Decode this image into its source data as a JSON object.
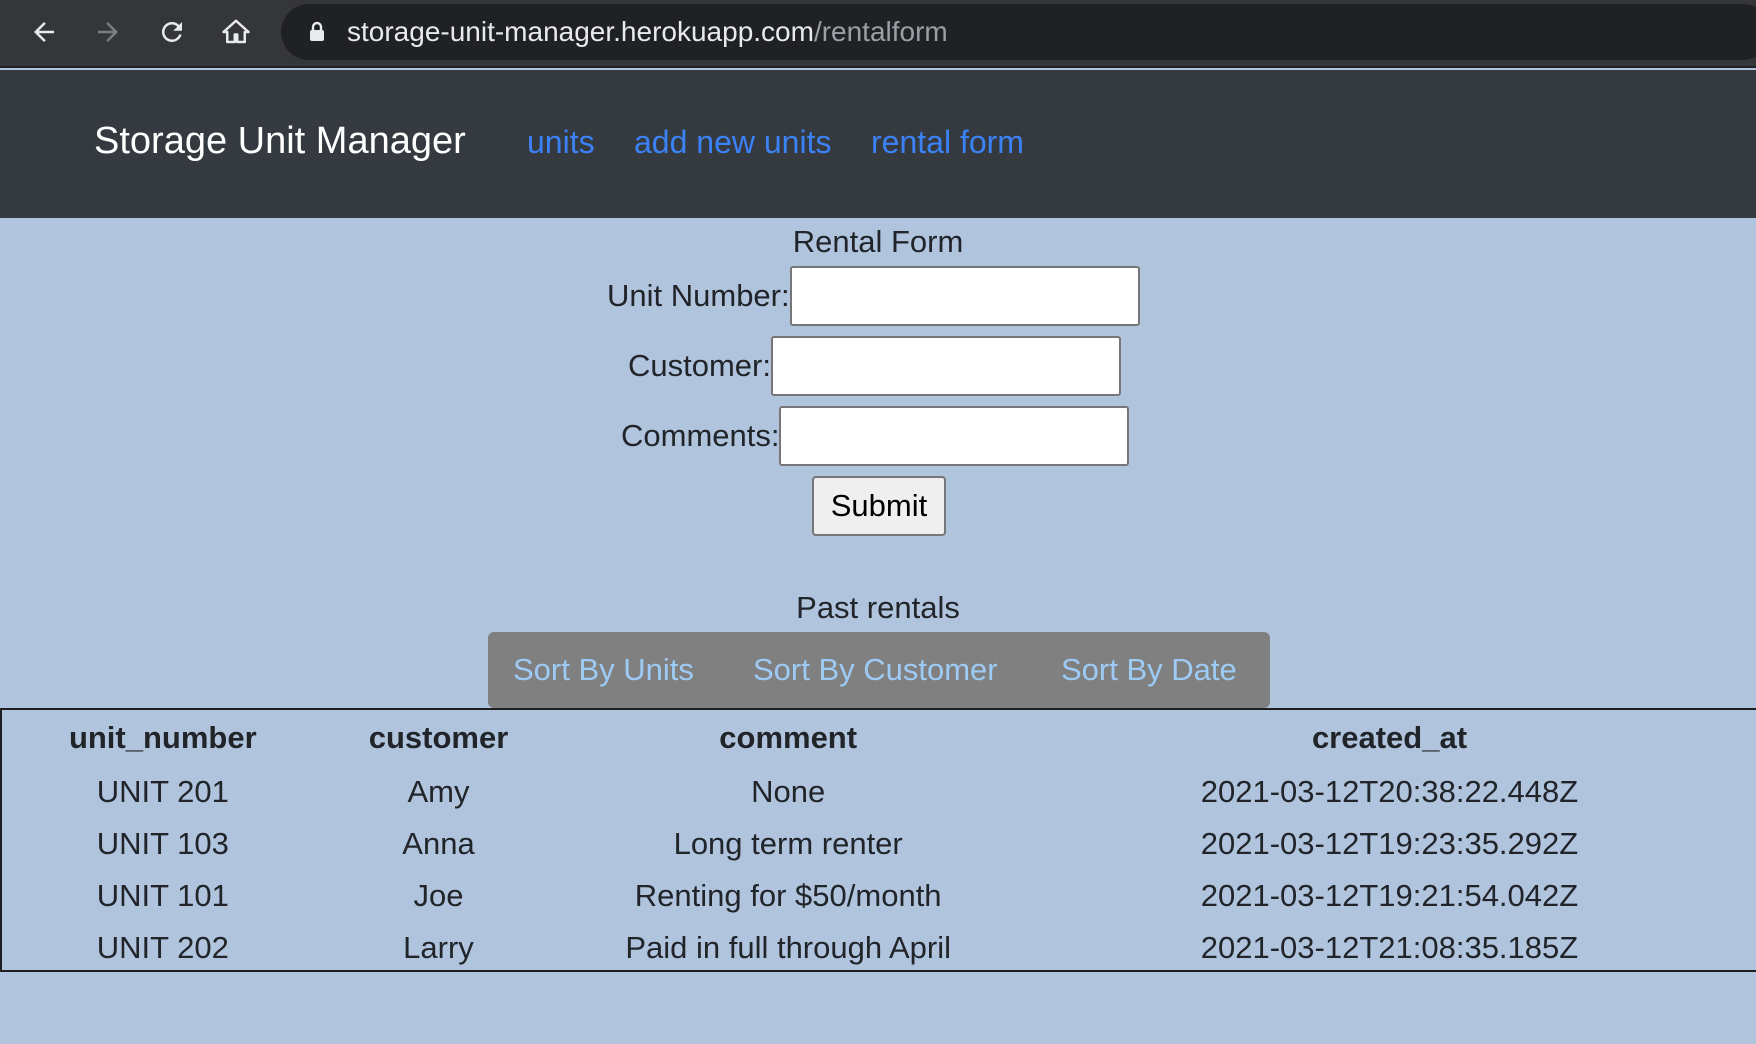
{
  "browser": {
    "url_host": "storage-unit-manager.herokuapp.com",
    "url_path": "/rentalform",
    "icons": [
      "back-arrow-icon",
      "forward-arrow-icon",
      "reload-icon",
      "home-icon",
      "lock-icon"
    ]
  },
  "navbar": {
    "brand": "Storage Unit Manager",
    "links": [
      "units",
      "add new units",
      "rental form"
    ]
  },
  "form": {
    "title": "Rental Form",
    "unit_label": "Unit Number:",
    "unit_value": "",
    "customer_label": "Customer:",
    "customer_value": "",
    "comments_label": "Comments:",
    "comments_value": "",
    "submit_label": "Submit"
  },
  "rentals": {
    "title": "Past rentals",
    "sort_buttons": [
      "Sort By Units",
      "Sort By Customer",
      "Sort By Date"
    ],
    "columns": [
      "unit_number",
      "customer",
      "comment",
      "created_at"
    ],
    "rows": [
      [
        "UNIT 201",
        "Amy",
        "None",
        "2021-03-12T20:38:22.448Z"
      ],
      [
        "UNIT 103",
        "Anna",
        "Long term renter",
        "2021-03-12T19:23:35.292Z"
      ],
      [
        "UNIT 101",
        "Joe",
        "Renting for $50/month",
        "2021-03-12T19:21:54.042Z"
      ],
      [
        "UNIT 202",
        "Larry",
        "Paid in full through April",
        "2021-03-12T21:08:35.185Z"
      ]
    ]
  },
  "colors": {
    "page_background": "#b0c4de",
    "navbar_background": "#343a40",
    "nav_link": "#3b82f6",
    "sort_bar": "#808080",
    "sort_link": "#9ecbf5"
  }
}
